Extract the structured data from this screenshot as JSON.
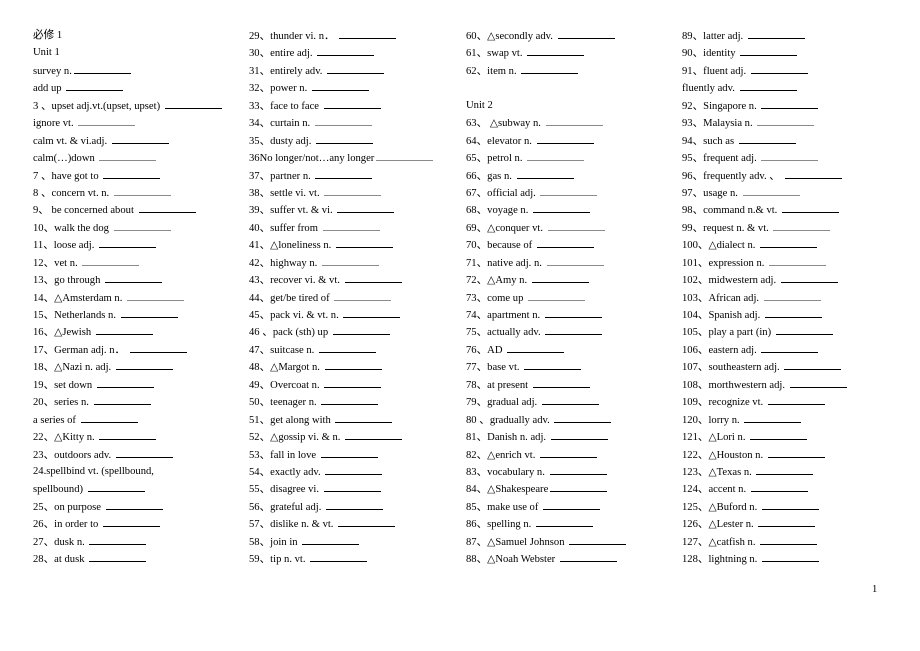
{
  "document": {
    "page_number": "1",
    "columns": [
      {
        "lines": [
          {
            "text": "必修 1",
            "blank": false
          },
          {
            "text": "Unit 1",
            "blank": false
          },
          {
            "text": "survey n.",
            "blank": true
          },
          {
            "text": "add up ",
            "blank": true
          },
          {
            "text": "3 、upset adj.vt.(upset, upset) ",
            "blank": true
          },
          {
            "text": "ignore vt. ",
            "blank": true,
            "dotted": true
          },
          {
            "text": "calm vt. & vi.adj. ",
            "blank": true
          },
          {
            "text": "calm(…)down ",
            "blank": true,
            "dotted": true
          },
          {
            "text": "7 、have got to ",
            "blank": true
          },
          {
            "text": "8 、concern vt.   n. ",
            "blank": true,
            "dotted": true
          },
          {
            "text": "9、  be concerned about ",
            "blank": true
          },
          {
            "text": "10、walk the dog ",
            "blank": true,
            "dotted": true
          },
          {
            "text": "11、loose adj. ",
            "blank": true
          },
          {
            "text": "12、vet n. ",
            "blank": true,
            "dotted": true
          },
          {
            "text": "13、go through ",
            "blank": true
          },
          {
            "text": "14、△Amsterdam n. ",
            "blank": true,
            "dotted": true
          },
          {
            "text": "15、Netherlands n. ",
            "blank": true
          },
          {
            "text": "16、△Jewish ",
            "blank": true
          },
          {
            "text": "17、German adj. n．  ",
            "blank": true
          },
          {
            "text": "18、△Nazi n.   adj. ",
            "blank": true
          },
          {
            "text": "19、set down ",
            "blank": true
          },
          {
            "text": "20、series n. ",
            "blank": true
          },
          {
            "text": "a series of ",
            "blank": true
          },
          {
            "text": "22、△Kitty n. ",
            "blank": true
          },
          {
            "text": "23、outdoors adv. ",
            "blank": true
          },
          {
            "text": "24.spellbind vt. (spellbound,",
            "blank": false
          },
          {
            "text": "spellbound) ",
            "blank": true
          },
          {
            "text": "25、on purpose ",
            "blank": true
          },
          {
            "text": "26、in order to ",
            "blank": true
          },
          {
            "text": "27、dusk n. ",
            "blank": true
          },
          {
            "text": "28、at dusk ",
            "blank": true
          }
        ]
      },
      {
        "lines": [
          {
            "text": "29、thunder vi. n．   ",
            "blank": true
          },
          {
            "text": "30、entire adj. ",
            "blank": true
          },
          {
            "text": "31、entirely adv. ",
            "blank": true
          },
          {
            "text": "32、power n. ",
            "blank": true
          },
          {
            "text": "33、face to face ",
            "blank": true
          },
          {
            "text": "34、curtain n. ",
            "blank": true,
            "dotted": true
          },
          {
            "text": "35、dusty adj. ",
            "blank": true
          },
          {
            "text": "36No longer/not…any longer",
            "blank": true,
            "dotted": true
          },
          {
            "text": "37、partner n. ",
            "blank": true
          },
          {
            "text": "38、settle vi. vt. ",
            "blank": true,
            "dotted": true
          },
          {
            "text": "39、suffer vt. & vi. ",
            "blank": true
          },
          {
            "text": "40、suffer from ",
            "blank": true,
            "dotted": true
          },
          {
            "text": "41、△loneliness n. ",
            "blank": true
          },
          {
            "text": "42、highway n. ",
            "blank": true,
            "dotted": true
          },
          {
            "text": "43、recover vi. & vt. ",
            "blank": true
          },
          {
            "text": "44、get/be tired of ",
            "blank": true,
            "dotted": true
          },
          {
            "text": "45、pack vi. & vt.   n. ",
            "blank": true
          },
          {
            "text": "46 、pack (sth) up ",
            "blank": true
          },
          {
            "text": "47、suitcase n. ",
            "blank": true
          },
          {
            "text": "48、△Margot n. ",
            "blank": true
          },
          {
            "text": "49、Overcoat n. ",
            "blank": true
          },
          {
            "text": "50、teenager n. ",
            "blank": true
          },
          {
            "text": "51、get along with ",
            "blank": true
          },
          {
            "text": "52、△gossip vi. & n. ",
            "blank": true
          },
          {
            "text": "53、fall in love ",
            "blank": true
          },
          {
            "text": "54、exactly adv. ",
            "blank": true
          },
          {
            "text": "55、disagree vi. ",
            "blank": true
          },
          {
            "text": "56、grateful adj. ",
            "blank": true
          },
          {
            "text": "57、dislike n. & vt. ",
            "blank": true
          },
          {
            "text": "58、join in ",
            "blank": true
          },
          {
            "text": "59、tip n.   vt. ",
            "blank": true
          }
        ]
      },
      {
        "lines": [
          {
            "text": "60、△secondly adv. ",
            "blank": true
          },
          {
            "text": "61、swap vt. ",
            "blank": true
          },
          {
            "text": "62、item n. ",
            "blank": true
          },
          {
            "text": "",
            "blank": false
          },
          {
            "text": "Unit 2",
            "blank": false
          },
          {
            "text": "63、  △subway n. ",
            "blank": true,
            "dotted": true
          },
          {
            "text": "64、elevator n. ",
            "blank": true
          },
          {
            "text": "65、petrol n. ",
            "blank": true,
            "dotted": true
          },
          {
            "text": "66、gas n. ",
            "blank": true
          },
          {
            "text": "67、official adj. ",
            "blank": true,
            "dotted": true
          },
          {
            "text": "68、voyage n. ",
            "blank": true
          },
          {
            "text": "69、△conquer vt. ",
            "blank": true,
            "dotted": true
          },
          {
            "text": "70、because of ",
            "blank": true
          },
          {
            "text": "71、native adj.   n. ",
            "blank": true,
            "dotted": true
          },
          {
            "text": "72、△Amy n. ",
            "blank": true
          },
          {
            "text": "73、come up ",
            "blank": true,
            "dotted": true
          },
          {
            "text": "74、apartment n. ",
            "blank": true
          },
          {
            "text": "75、actually adv. ",
            "blank": true
          },
          {
            "text": "76、AD ",
            "blank": true
          },
          {
            "text": "77、base vt. ",
            "blank": true
          },
          {
            "text": "78、at present ",
            "blank": true
          },
          {
            "text": "79、gradual adj. ",
            "blank": true
          },
          {
            "text": "80 、gradually adv. ",
            "blank": true
          },
          {
            "text": "81、Danish n. adj. ",
            "blank": true
          },
          {
            "text": "82、△enrich vt. ",
            "blank": true
          },
          {
            "text": "83、vocabulary n. ",
            "blank": true
          },
          {
            "text": "84、△Shakespeare",
            "blank": true
          },
          {
            "text": "85、make use of ",
            "blank": true
          },
          {
            "text": "86、spelling n. ",
            "blank": true
          },
          {
            "text": "87、△Samuel Johnson ",
            "blank": true
          },
          {
            "text": "88、△Noah Webster ",
            "blank": true
          }
        ]
      },
      {
        "lines": [
          {
            "text": "89、latter adj. ",
            "blank": true
          },
          {
            "text": "90、identity ",
            "blank": true
          },
          {
            "text": "91、fluent adj. ",
            "blank": true
          },
          {
            "text": "fluently adv. ",
            "blank": true
          },
          {
            "text": "92、Singapore n. ",
            "blank": true
          },
          {
            "text": "93、Malaysia n. ",
            "blank": true,
            "dotted": true
          },
          {
            "text": "94、such as ",
            "blank": true
          },
          {
            "text": "95、frequent adj. ",
            "blank": true,
            "dotted": true
          },
          {
            "text": "96、frequently adv. 、 ",
            "blank": true
          },
          {
            "text": "97、usage n. ",
            "blank": true,
            "dotted": true
          },
          {
            "text": "98、command n.& vt. ",
            "blank": true
          },
          {
            "text": "99、request n. & vt. ",
            "blank": true,
            "dotted": true
          },
          {
            "text": "100、△dialect n. ",
            "blank": true
          },
          {
            "text": "101、expression n. ",
            "blank": true,
            "dotted": true
          },
          {
            "text": "102、midwestern adj. ",
            "blank": true
          },
          {
            "text": "103、African adj. ",
            "blank": true,
            "dotted": true
          },
          {
            "text": "104、Spanish adj. ",
            "blank": true
          },
          {
            "text": "105、play a part (in) ",
            "blank": true
          },
          {
            "text": "106、eastern adj. ",
            "blank": true
          },
          {
            "text": "107、southeastern adj. ",
            "blank": true
          },
          {
            "text": "108、morthwestern adj. ",
            "blank": true
          },
          {
            "text": "109、recognize vt. ",
            "blank": true
          },
          {
            "text": "120、lorry n. ",
            "blank": true
          },
          {
            "text": "121、△Lori n. ",
            "blank": true
          },
          {
            "text": "122、△Houston n. ",
            "blank": true
          },
          {
            "text": "123、△Texas n. ",
            "blank": true
          },
          {
            "text": "124、accent n. ",
            "blank": true
          },
          {
            "text": "125、△Buford n. ",
            "blank": true
          },
          {
            "text": "126、△Lester n. ",
            "blank": true
          },
          {
            "text": "127、△catfish n. ",
            "blank": true
          },
          {
            "text": "128、lightning n. ",
            "blank": true
          }
        ]
      }
    ]
  }
}
